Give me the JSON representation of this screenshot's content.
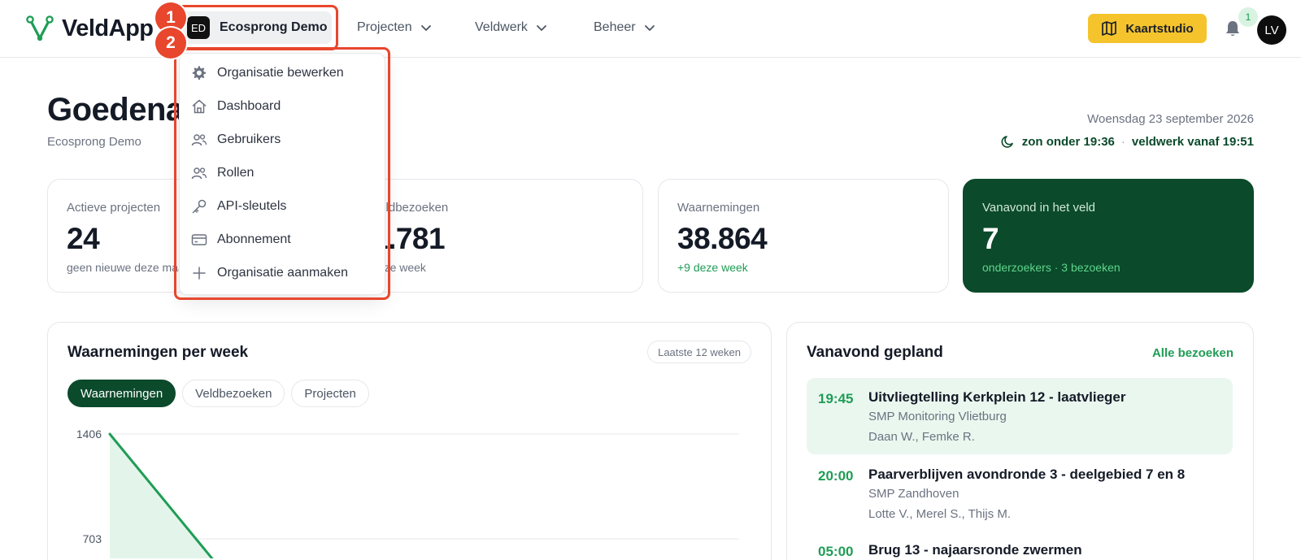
{
  "app": {
    "name": "VeldApp"
  },
  "header": {
    "org_initials": "ED",
    "org_name": "Ecosprong Demo",
    "nav": [
      {
        "label": "Projecten"
      },
      {
        "label": "Veldwerk"
      },
      {
        "label": "Beheer"
      }
    ],
    "map_button": "Kaartstudio",
    "notification_count": "1",
    "user_initials": "LV"
  },
  "greeting": {
    "title": "Goedenavond",
    "org": "Ecosprong Demo",
    "date": "Woensdag 23 september 2026",
    "sunset": "zon onder 19:36",
    "separator": "·",
    "fieldwork": "veldwerk vanaf 19:51"
  },
  "stats": [
    {
      "label": "Actieve projecten",
      "value": "24",
      "sub": "geen nieuwe deze maand"
    },
    {
      "label": "Veldbezoeken",
      "value": "1.781",
      "sub": "deze week"
    },
    {
      "label": "Waarnemingen",
      "value": "38.864",
      "sub": "+9 deze week"
    },
    {
      "label": "Vanavond in het veld",
      "value": "7",
      "sub": "onderzoekers · 3 bezoeken"
    }
  ],
  "chart_panel": {
    "title": "Waarnemingen per week",
    "range": "Laatste 12 weken",
    "tabs": [
      {
        "label": "Waarnemingen"
      },
      {
        "label": "Veldbezoeken"
      },
      {
        "label": "Projecten"
      }
    ]
  },
  "chart_data": {
    "type": "area",
    "title": "",
    "xlabel": "",
    "ylabel": "",
    "yticks": [
      "1406",
      "703"
    ],
    "ylim": [
      0,
      1406
    ],
    "x": [
      1,
      2
    ],
    "series": [
      {
        "values": [
          1406,
          703
        ]
      }
    ]
  },
  "tonight_panel": {
    "title": "Vanavond gepland",
    "link": "Alle bezoeken",
    "visits": [
      {
        "time": "19:45",
        "title": "Uitvliegtelling Kerkplein 12 - laatvlieger",
        "project": "SMP Monitoring Vlietburg",
        "people": "Daan W., Femke R."
      },
      {
        "time": "20:00",
        "title": "Paarverblijven avondronde 3 - deelgebied 7 en 8",
        "project": "SMP Zandhoven",
        "people": "Lotte V., Merel S., Thijs M."
      },
      {
        "time": "05:00",
        "title": "Brug 13 - najaarsronde zwermen",
        "project": "",
        "people": ""
      }
    ]
  },
  "org_menu": {
    "items": [
      {
        "label": "Organisatie bewerken",
        "icon": "gear-icon"
      },
      {
        "label": "Dashboard",
        "icon": "home-icon"
      },
      {
        "label": "Gebruikers",
        "icon": "users-icon"
      },
      {
        "label": "Rollen",
        "icon": "roles-icon"
      },
      {
        "label": "API-sleutels",
        "icon": "key-icon"
      },
      {
        "label": "Abonnement",
        "icon": "card-icon"
      },
      {
        "label": "Organisatie aanmaken",
        "icon": "plus-icon"
      }
    ]
  },
  "annotations": [
    {
      "label": "1"
    },
    {
      "label": "2"
    }
  ],
  "colors": {
    "brand_green": "#0b4a2b",
    "accent_green": "#1f9d55",
    "yellow": "#f5c42c",
    "annotation": "#e8462d"
  }
}
